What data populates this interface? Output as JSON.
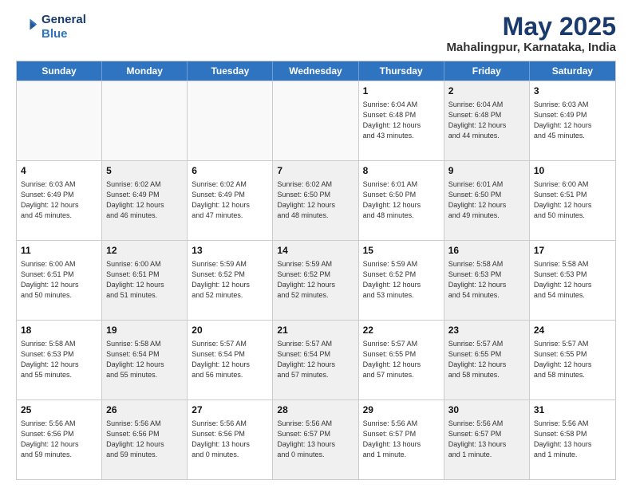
{
  "header": {
    "logo_line1": "General",
    "logo_line2": "Blue",
    "month": "May 2025",
    "location": "Mahalingpur, Karnataka, India"
  },
  "days_of_week": [
    "Sunday",
    "Monday",
    "Tuesday",
    "Wednesday",
    "Thursday",
    "Friday",
    "Saturday"
  ],
  "weeks": [
    [
      {
        "day": "",
        "info": "",
        "shaded": false,
        "empty": true
      },
      {
        "day": "",
        "info": "",
        "shaded": false,
        "empty": true
      },
      {
        "day": "",
        "info": "",
        "shaded": false,
        "empty": true
      },
      {
        "day": "",
        "info": "",
        "shaded": false,
        "empty": true
      },
      {
        "day": "1",
        "info": "Sunrise: 6:04 AM\nSunset: 6:48 PM\nDaylight: 12 hours\nand 43 minutes.",
        "shaded": false,
        "empty": false
      },
      {
        "day": "2",
        "info": "Sunrise: 6:04 AM\nSunset: 6:48 PM\nDaylight: 12 hours\nand 44 minutes.",
        "shaded": true,
        "empty": false
      },
      {
        "day": "3",
        "info": "Sunrise: 6:03 AM\nSunset: 6:49 PM\nDaylight: 12 hours\nand 45 minutes.",
        "shaded": false,
        "empty": false
      }
    ],
    [
      {
        "day": "4",
        "info": "Sunrise: 6:03 AM\nSunset: 6:49 PM\nDaylight: 12 hours\nand 45 minutes.",
        "shaded": false,
        "empty": false
      },
      {
        "day": "5",
        "info": "Sunrise: 6:02 AM\nSunset: 6:49 PM\nDaylight: 12 hours\nand 46 minutes.",
        "shaded": true,
        "empty": false
      },
      {
        "day": "6",
        "info": "Sunrise: 6:02 AM\nSunset: 6:49 PM\nDaylight: 12 hours\nand 47 minutes.",
        "shaded": false,
        "empty": false
      },
      {
        "day": "7",
        "info": "Sunrise: 6:02 AM\nSunset: 6:50 PM\nDaylight: 12 hours\nand 48 minutes.",
        "shaded": true,
        "empty": false
      },
      {
        "day": "8",
        "info": "Sunrise: 6:01 AM\nSunset: 6:50 PM\nDaylight: 12 hours\nand 48 minutes.",
        "shaded": false,
        "empty": false
      },
      {
        "day": "9",
        "info": "Sunrise: 6:01 AM\nSunset: 6:50 PM\nDaylight: 12 hours\nand 49 minutes.",
        "shaded": true,
        "empty": false
      },
      {
        "day": "10",
        "info": "Sunrise: 6:00 AM\nSunset: 6:51 PM\nDaylight: 12 hours\nand 50 minutes.",
        "shaded": false,
        "empty": false
      }
    ],
    [
      {
        "day": "11",
        "info": "Sunrise: 6:00 AM\nSunset: 6:51 PM\nDaylight: 12 hours\nand 50 minutes.",
        "shaded": false,
        "empty": false
      },
      {
        "day": "12",
        "info": "Sunrise: 6:00 AM\nSunset: 6:51 PM\nDaylight: 12 hours\nand 51 minutes.",
        "shaded": true,
        "empty": false
      },
      {
        "day": "13",
        "info": "Sunrise: 5:59 AM\nSunset: 6:52 PM\nDaylight: 12 hours\nand 52 minutes.",
        "shaded": false,
        "empty": false
      },
      {
        "day": "14",
        "info": "Sunrise: 5:59 AM\nSunset: 6:52 PM\nDaylight: 12 hours\nand 52 minutes.",
        "shaded": true,
        "empty": false
      },
      {
        "day": "15",
        "info": "Sunrise: 5:59 AM\nSunset: 6:52 PM\nDaylight: 12 hours\nand 53 minutes.",
        "shaded": false,
        "empty": false
      },
      {
        "day": "16",
        "info": "Sunrise: 5:58 AM\nSunset: 6:53 PM\nDaylight: 12 hours\nand 54 minutes.",
        "shaded": true,
        "empty": false
      },
      {
        "day": "17",
        "info": "Sunrise: 5:58 AM\nSunset: 6:53 PM\nDaylight: 12 hours\nand 54 minutes.",
        "shaded": false,
        "empty": false
      }
    ],
    [
      {
        "day": "18",
        "info": "Sunrise: 5:58 AM\nSunset: 6:53 PM\nDaylight: 12 hours\nand 55 minutes.",
        "shaded": false,
        "empty": false
      },
      {
        "day": "19",
        "info": "Sunrise: 5:58 AM\nSunset: 6:54 PM\nDaylight: 12 hours\nand 55 minutes.",
        "shaded": true,
        "empty": false
      },
      {
        "day": "20",
        "info": "Sunrise: 5:57 AM\nSunset: 6:54 PM\nDaylight: 12 hours\nand 56 minutes.",
        "shaded": false,
        "empty": false
      },
      {
        "day": "21",
        "info": "Sunrise: 5:57 AM\nSunset: 6:54 PM\nDaylight: 12 hours\nand 57 minutes.",
        "shaded": true,
        "empty": false
      },
      {
        "day": "22",
        "info": "Sunrise: 5:57 AM\nSunset: 6:55 PM\nDaylight: 12 hours\nand 57 minutes.",
        "shaded": false,
        "empty": false
      },
      {
        "day": "23",
        "info": "Sunrise: 5:57 AM\nSunset: 6:55 PM\nDaylight: 12 hours\nand 58 minutes.",
        "shaded": true,
        "empty": false
      },
      {
        "day": "24",
        "info": "Sunrise: 5:57 AM\nSunset: 6:55 PM\nDaylight: 12 hours\nand 58 minutes.",
        "shaded": false,
        "empty": false
      }
    ],
    [
      {
        "day": "25",
        "info": "Sunrise: 5:56 AM\nSunset: 6:56 PM\nDaylight: 12 hours\nand 59 minutes.",
        "shaded": false,
        "empty": false
      },
      {
        "day": "26",
        "info": "Sunrise: 5:56 AM\nSunset: 6:56 PM\nDaylight: 12 hours\nand 59 minutes.",
        "shaded": true,
        "empty": false
      },
      {
        "day": "27",
        "info": "Sunrise: 5:56 AM\nSunset: 6:56 PM\nDaylight: 13 hours\nand 0 minutes.",
        "shaded": false,
        "empty": false
      },
      {
        "day": "28",
        "info": "Sunrise: 5:56 AM\nSunset: 6:57 PM\nDaylight: 13 hours\nand 0 minutes.",
        "shaded": true,
        "empty": false
      },
      {
        "day": "29",
        "info": "Sunrise: 5:56 AM\nSunset: 6:57 PM\nDaylight: 13 hours\nand 1 minute.",
        "shaded": false,
        "empty": false
      },
      {
        "day": "30",
        "info": "Sunrise: 5:56 AM\nSunset: 6:57 PM\nDaylight: 13 hours\nand 1 minute.",
        "shaded": true,
        "empty": false
      },
      {
        "day": "31",
        "info": "Sunrise: 5:56 AM\nSunset: 6:58 PM\nDaylight: 13 hours\nand 1 minute.",
        "shaded": false,
        "empty": false
      }
    ]
  ]
}
